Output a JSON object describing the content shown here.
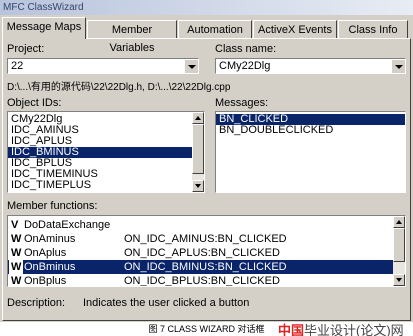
{
  "title": "MFC ClassWizard",
  "tabs": [
    "Message Maps",
    "Member Variables",
    "Automation",
    "ActiveX Events",
    "Class Info"
  ],
  "project": {
    "label": "Project:",
    "value": "22"
  },
  "class_name": {
    "label": "Class name:",
    "value": "CMy22Dlg"
  },
  "path": "D:\\...\\有用的源代码\\22\\22Dlg.h, D:\\...\\22\\22Dlg.cpp",
  "object_ids": {
    "label": "Object IDs:",
    "items": [
      "CMy22Dlg",
      "IDC_AMINUS",
      "IDC_APLUS",
      "IDC_BMINUS",
      "IDC_BPLUS",
      "IDC_TIMEMINUS",
      "IDC_TIMEPLUS"
    ],
    "selected": "IDC_BMINUS"
  },
  "messages": {
    "label": "Messages:",
    "items": [
      "BN_CLICKED",
      "BN_DOUBLECLICKED"
    ],
    "selected": "BN_CLICKED"
  },
  "member_functions": {
    "label": "Member functions:",
    "rows": [
      {
        "kind": "V",
        "name": "DoDataExchange",
        "mapping": ""
      },
      {
        "kind": "W",
        "name": "OnAminus",
        "mapping": "ON_IDC_AMINUS:BN_CLICKED"
      },
      {
        "kind": "W",
        "name": "OnAplus",
        "mapping": "ON_IDC_APLUS:BN_CLICKED"
      },
      {
        "kind": "W",
        "name": "OnBminus",
        "mapping": "ON_IDC_BMINUS:BN_CLICKED"
      },
      {
        "kind": "W",
        "name": "OnBplus",
        "mapping": "ON_IDC_BPLUS:BN_CLICKED"
      }
    ],
    "selected": "OnBminus"
  },
  "description": {
    "label": "Description:",
    "text": "Indicates the user clicked a button"
  },
  "caption": "图 7 CLASS WIZARD 对话框",
  "brand": {
    "mark": "中国",
    "text": "毕业设计(论文)网"
  },
  "colors": {
    "face": "#d4d0c8",
    "selection": "#0a246a",
    "title_text": "#34456e"
  }
}
